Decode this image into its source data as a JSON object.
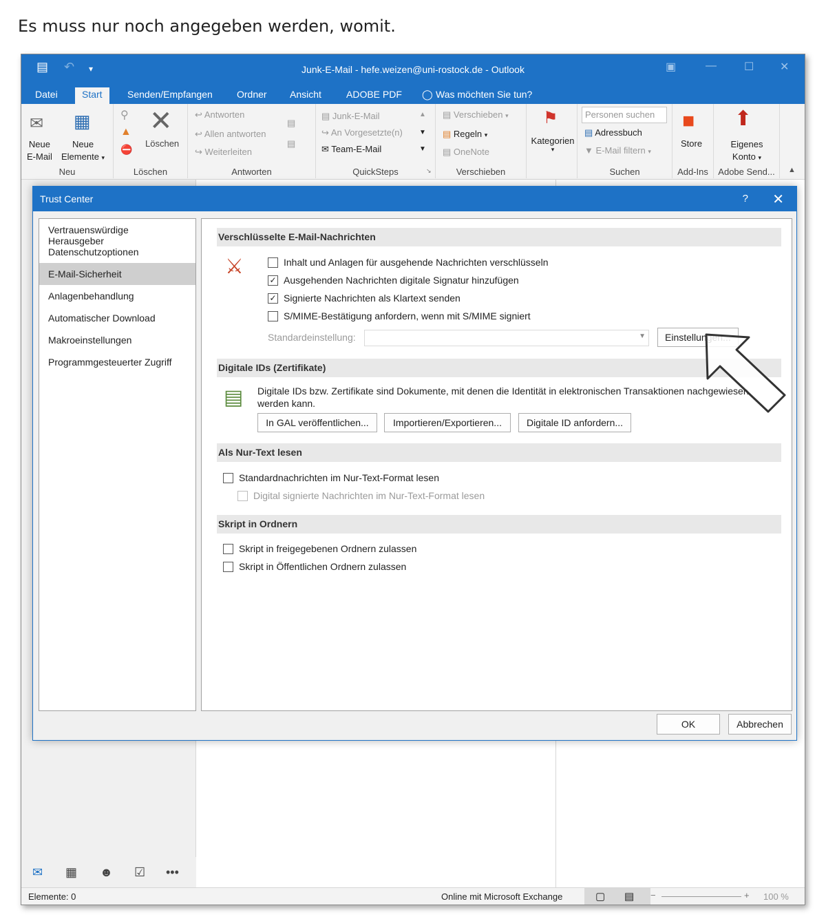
{
  "caption": "Es muss nur noch angegeben werden, womit.",
  "window": {
    "title": "Junk-E-Mail - hefe.weizen@uni-rostock.de - Outlook",
    "tabs": [
      "Datei",
      "Start",
      "Senden/Empfangen",
      "Ordner",
      "Ansicht",
      "ADOBE PDF",
      "Was möchten Sie tun?"
    ],
    "active_tab": "Start"
  },
  "ribbon": {
    "neu": {
      "label": "Neu",
      "new_email_line1": "Neue",
      "new_email_line2": "E-Mail",
      "new_items_line1": "Neue",
      "new_items_line2": "Elemente"
    },
    "loeschen": {
      "label": "Löschen",
      "delete": "Löschen"
    },
    "antworten": {
      "label": "Antworten",
      "reply": "Antworten",
      "reply_all": "Allen antworten",
      "forward": "Weiterleiten"
    },
    "quicksteps": {
      "label": "QuickSteps",
      "items": [
        "Junk-E-Mail",
        "An Vorgesetzte(n)",
        "Team-E-Mail"
      ]
    },
    "verschieben": {
      "label": "Verschieben",
      "move": "Verschieben",
      "rules": "Regeln",
      "onenote": "OneNote"
    },
    "kategorien": {
      "label": "Kategorien"
    },
    "suchen": {
      "label": "Suchen",
      "placeholder": "Personen suchen",
      "address_book": "Adressbuch",
      "filter": "E-Mail filtern"
    },
    "addins": {
      "label": "Add-Ins",
      "store": "Store"
    },
    "adobe": {
      "label": "Adobe Send...",
      "account_line1": "Eigenes",
      "account_line2": "Konto"
    }
  },
  "dialog": {
    "title": "Trust Center",
    "help": "?",
    "nav": [
      "Vertrauenswürdige Herausgeber",
      "Datenschutzoptionen",
      "E-Mail-Sicherheit",
      "Anlagenbehandlung",
      "Automatischer Download",
      "Makroeinstellungen",
      "Programmgesteuerter Zugriff"
    ],
    "selected_nav": "E-Mail-Sicherheit",
    "sections": {
      "encrypted": {
        "heading": "Verschlüsselte E-Mail-Nachrichten",
        "options": [
          {
            "label": "Inhalt und Anlagen für ausgehende Nachrichten verschlüsseln",
            "checked": false
          },
          {
            "label": "Ausgehenden Nachrichten digitale Signatur hinzufügen",
            "checked": true
          },
          {
            "label": "Signierte Nachrichten als Klartext senden",
            "checked": true
          },
          {
            "label": "S/MIME-Bestätigung anfordern, wenn mit S/MIME signiert",
            "checked": false
          }
        ],
        "default_setting_label": "Standardeinstellung:",
        "settings_button": "Einstellungen..."
      },
      "digital_ids": {
        "heading": "Digitale IDs (Zertifikate)",
        "text": "Digitale IDs bzw. Zertifikate sind Dokumente, mit denen die Identität in elektronischen Transaktionen nachgewiesen werden kann.",
        "buttons": [
          "In GAL veröffentlichen...",
          "Importieren/Exportieren...",
          "Digitale ID anfordern..."
        ]
      },
      "plain_text": {
        "heading": "Als Nur-Text lesen",
        "options": [
          {
            "label": "Standardnachrichten im Nur-Text-Format lesen",
            "checked": false,
            "enabled": true
          },
          {
            "label": "Digital signierte Nachrichten im Nur-Text-Format lesen",
            "checked": false,
            "enabled": false
          }
        ]
      },
      "script": {
        "heading": "Skript in Ordnern",
        "options": [
          {
            "label": "Skript in freigegebenen Ordnern zulassen",
            "checked": false
          },
          {
            "label": "Skript in Öffentlichen Ordnern zulassen",
            "checked": false
          }
        ]
      }
    },
    "ok": "OK",
    "cancel": "Abbrechen"
  },
  "statusbar": {
    "items_count": "Elemente: 0",
    "connection": "Online mit Microsoft Exchange",
    "zoom": "100 %"
  }
}
